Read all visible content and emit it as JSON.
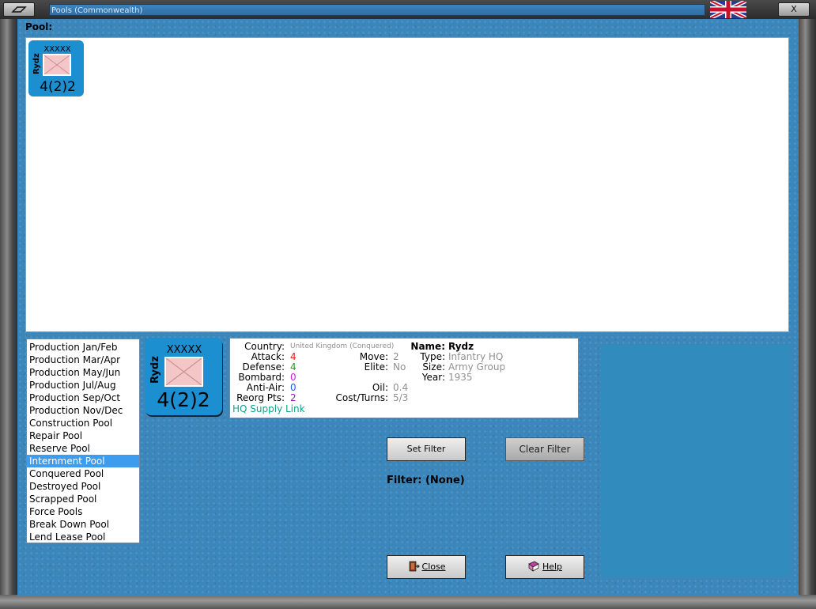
{
  "window": {
    "title": "Pools (Commonwealth)",
    "close_label": "X"
  },
  "pool": {
    "label": "Pool:",
    "units": [
      {
        "name": "Rydz",
        "size": "XXXXX",
        "strength": "4(2)2"
      }
    ]
  },
  "pool_list": {
    "items": [
      "Production Jan/Feb",
      "Production Mar/Apr",
      "Production May/Jun",
      "Production Jul/Aug",
      "Production Sep/Oct",
      "Production Nov/Dec",
      "Construction Pool",
      "Repair Pool",
      "Reserve Pool",
      "Internment Pool",
      "Conquered Pool",
      "Destroyed Pool",
      "Scrapped Pool",
      "Force Pools",
      "Break Down Pool",
      "Lend Lease Pool"
    ],
    "selected": "Internment Pool"
  },
  "selected_unit": {
    "name": "Rydz",
    "size": "XXXXX",
    "strength": "4(2)2"
  },
  "info": {
    "country_label": "Country:",
    "country": "United Kingdom (Conquered)",
    "attack_label": "Attack:",
    "attack": "4",
    "defense_label": "Defense:",
    "defense": "4",
    "bombard_label": "Bombard:",
    "bombard": "0",
    "antiair_label": "Anti-Air:",
    "antiair": "0",
    "reorg_label": "Reorg Pts:",
    "reorg": "2",
    "hq_link": "HQ Supply Link",
    "move_label": "Move:",
    "move": "2",
    "elite_label": "Elite:",
    "elite": "No",
    "oil_label": "Oil:",
    "oil": "0.4",
    "cost_label": "Cost/Turns:",
    "cost": "5/3",
    "name_label": "Name:",
    "name": "Rydz",
    "type_label": "Type:",
    "type": "Infantry HQ",
    "size_label": "Size:",
    "size": "Army Group",
    "year_label": "Year:",
    "year": "1935"
  },
  "filter": {
    "set_label": "Set Filter",
    "clear_label": "Clear Filter",
    "status": "Filter: (None)"
  },
  "buttons": {
    "close_label": "Close",
    "help_label": "Help"
  },
  "colors": {
    "background": "#3b87bc",
    "counter": "#1c8fd0",
    "attack": "#e02020",
    "defense": "#20a020",
    "bombard": "#d020d0",
    "antiair": "#2060e0",
    "reorg": "#9020b0",
    "hq_link": "#10a090",
    "muted": "#909090",
    "selection": "#3c9cf0"
  }
}
